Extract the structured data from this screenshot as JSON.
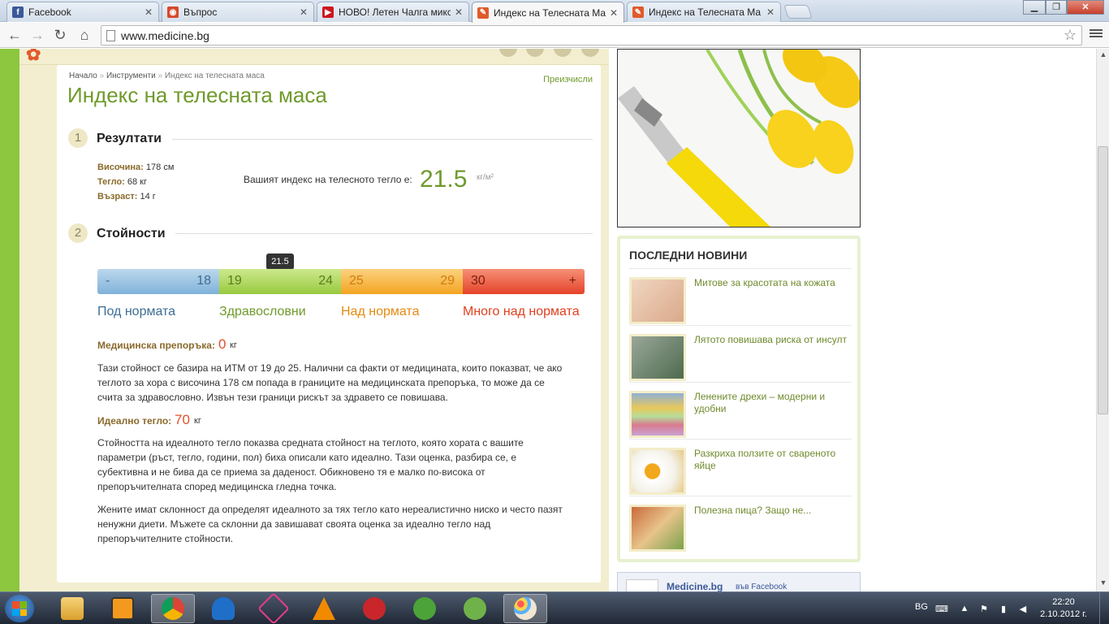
{
  "tabs": [
    {
      "label": "Facebook",
      "icon": "facebook-icon",
      "color": "#3b5998"
    },
    {
      "label": "Въпрос",
      "icon": "chrome-app-icon",
      "color": "#d8472b"
    },
    {
      "label": "НОВО! Летен Чалга микс",
      "icon": "youtube-icon",
      "color": "#cc181e"
    },
    {
      "label": "Индекс на Телесната Ма",
      "icon": "medicine-icon",
      "color": "#e05a2b"
    },
    {
      "label": "Индекс на Телесната Ма",
      "icon": "medicine-icon",
      "color": "#e05a2b"
    }
  ],
  "address_bar": {
    "url": "www.medicine.bg"
  },
  "page": {
    "breadcrumb": [
      "Начало",
      "Инструменти",
      "Индекс на телесната маса"
    ],
    "recalc_label": "Преизчисли",
    "title": "Индекс на телесната маса",
    "section1": {
      "num": "1",
      "title": "Резултати"
    },
    "section2": {
      "num": "2",
      "title": "Стойности"
    },
    "stats": {
      "height_label": "Височина:",
      "height_value": "178 см",
      "weight_label": "Тегло:",
      "weight_value": "68 кг",
      "age_label": "Възраст:",
      "age_value": "14 г"
    },
    "bmi": {
      "label": "Вашият индекс на телесното тегло е:",
      "value": "21.5",
      "unit": "кг/м²"
    },
    "scale": {
      "marker": "21.5",
      "segments": [
        {
          "left": "-",
          "right": "18",
          "name": "Под нормата",
          "color": "#3d6e96"
        },
        {
          "left": "19",
          "right": "24",
          "name": "Здравословни",
          "color": "#6f9a2c"
        },
        {
          "left": "25",
          "right": "29",
          "name": "Над нормата",
          "color": "#e58a12"
        },
        {
          "left": "30",
          "right": "+",
          "name": "Много над нормата",
          "color": "#e0401f"
        }
      ]
    },
    "recommendation": {
      "label": "Медицинска препоръка:",
      "value": "0",
      "unit": "кг"
    },
    "recommendation_text": "Тази стойност се базира на ИТМ от 19 до 25. Налични са факти от медицината, които показват, че ако теглото за хора с височина 178 см попада в границите на медицинската препоръка, то може да се счита за здравословно. Извън тези граници рискът за здравето се повишава.",
    "ideal": {
      "label": "Идеално тегло:",
      "value": "70",
      "unit": "кг"
    },
    "ideal_text1": "Стойността на идеалното тегло показва средната стойност на теглото, която хората с вашите параметри (ръст, тегло, години, пол) биха описали като идеално. Тази оценка, разбира се, е субективна и не бива да се приема за даденост. Обикновено тя е малко по-висока от препоръчителната според медицинска гледна точка.",
    "ideal_text2": "Жените имат склонност да определят идеалното за тях тегло като нереалистично ниско и често пазят ненужни диети. Мъжете са склонни да завишават своята оценка за идеално тегло над препоръчителните стойности."
  },
  "news": {
    "title": "ПОСЛЕДНИ НОВИНИ",
    "items": [
      {
        "title": "Митове за красотата на кожата"
      },
      {
        "title": "Лятото повишава риска от инсулт"
      },
      {
        "title": "Ленените дрехи – модерни и удобни"
      },
      {
        "title": "Разкриха ползите от свареното яйце"
      },
      {
        "title": "Полезна пица? Защо не..."
      }
    ]
  },
  "facebook_box": {
    "name": "Medicine.bg",
    "suffix": "във Facebook"
  },
  "taskbar": {
    "lang": "BG",
    "time": "22:20",
    "date": "2.10.2012 г."
  }
}
